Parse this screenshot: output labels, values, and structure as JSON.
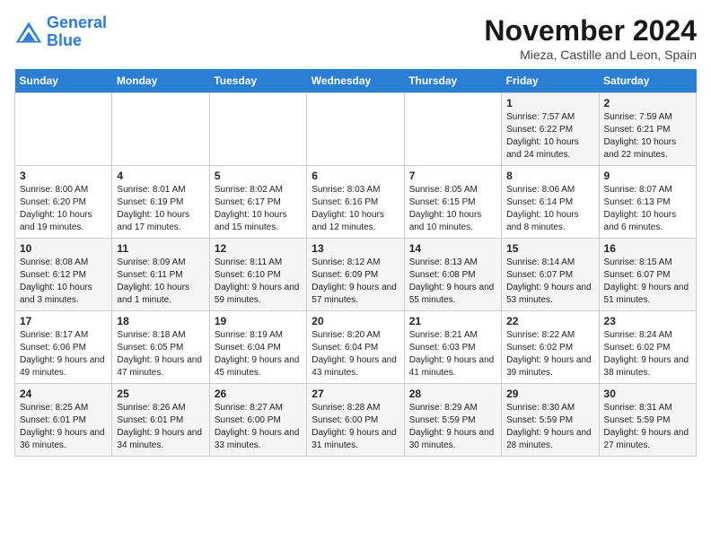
{
  "logo": {
    "line1": "General",
    "line2": "Blue"
  },
  "title": "November 2024",
  "subtitle": "Mieza, Castille and Leon, Spain",
  "weekdays": [
    "Sunday",
    "Monday",
    "Tuesday",
    "Wednesday",
    "Thursday",
    "Friday",
    "Saturday"
  ],
  "weeks": [
    [
      {
        "day": "",
        "info": ""
      },
      {
        "day": "",
        "info": ""
      },
      {
        "day": "",
        "info": ""
      },
      {
        "day": "",
        "info": ""
      },
      {
        "day": "",
        "info": ""
      },
      {
        "day": "1",
        "info": "Sunrise: 7:57 AM\nSunset: 6:22 PM\nDaylight: 10 hours and 24 minutes."
      },
      {
        "day": "2",
        "info": "Sunrise: 7:59 AM\nSunset: 6:21 PM\nDaylight: 10 hours and 22 minutes."
      }
    ],
    [
      {
        "day": "3",
        "info": "Sunrise: 8:00 AM\nSunset: 6:20 PM\nDaylight: 10 hours and 19 minutes."
      },
      {
        "day": "4",
        "info": "Sunrise: 8:01 AM\nSunset: 6:19 PM\nDaylight: 10 hours and 17 minutes."
      },
      {
        "day": "5",
        "info": "Sunrise: 8:02 AM\nSunset: 6:17 PM\nDaylight: 10 hours and 15 minutes."
      },
      {
        "day": "6",
        "info": "Sunrise: 8:03 AM\nSunset: 6:16 PM\nDaylight: 10 hours and 12 minutes."
      },
      {
        "day": "7",
        "info": "Sunrise: 8:05 AM\nSunset: 6:15 PM\nDaylight: 10 hours and 10 minutes."
      },
      {
        "day": "8",
        "info": "Sunrise: 8:06 AM\nSunset: 6:14 PM\nDaylight: 10 hours and 8 minutes."
      },
      {
        "day": "9",
        "info": "Sunrise: 8:07 AM\nSunset: 6:13 PM\nDaylight: 10 hours and 6 minutes."
      }
    ],
    [
      {
        "day": "10",
        "info": "Sunrise: 8:08 AM\nSunset: 6:12 PM\nDaylight: 10 hours and 3 minutes."
      },
      {
        "day": "11",
        "info": "Sunrise: 8:09 AM\nSunset: 6:11 PM\nDaylight: 10 hours and 1 minute."
      },
      {
        "day": "12",
        "info": "Sunrise: 8:11 AM\nSunset: 6:10 PM\nDaylight: 9 hours and 59 minutes."
      },
      {
        "day": "13",
        "info": "Sunrise: 8:12 AM\nSunset: 6:09 PM\nDaylight: 9 hours and 57 minutes."
      },
      {
        "day": "14",
        "info": "Sunrise: 8:13 AM\nSunset: 6:08 PM\nDaylight: 9 hours and 55 minutes."
      },
      {
        "day": "15",
        "info": "Sunrise: 8:14 AM\nSunset: 6:07 PM\nDaylight: 9 hours and 53 minutes."
      },
      {
        "day": "16",
        "info": "Sunrise: 8:15 AM\nSunset: 6:07 PM\nDaylight: 9 hours and 51 minutes."
      }
    ],
    [
      {
        "day": "17",
        "info": "Sunrise: 8:17 AM\nSunset: 6:06 PM\nDaylight: 9 hours and 49 minutes."
      },
      {
        "day": "18",
        "info": "Sunrise: 8:18 AM\nSunset: 6:05 PM\nDaylight: 9 hours and 47 minutes."
      },
      {
        "day": "19",
        "info": "Sunrise: 8:19 AM\nSunset: 6:04 PM\nDaylight: 9 hours and 45 minutes."
      },
      {
        "day": "20",
        "info": "Sunrise: 8:20 AM\nSunset: 6:04 PM\nDaylight: 9 hours and 43 minutes."
      },
      {
        "day": "21",
        "info": "Sunrise: 8:21 AM\nSunset: 6:03 PM\nDaylight: 9 hours and 41 minutes."
      },
      {
        "day": "22",
        "info": "Sunrise: 8:22 AM\nSunset: 6:02 PM\nDaylight: 9 hours and 39 minutes."
      },
      {
        "day": "23",
        "info": "Sunrise: 8:24 AM\nSunset: 6:02 PM\nDaylight: 9 hours and 38 minutes."
      }
    ],
    [
      {
        "day": "24",
        "info": "Sunrise: 8:25 AM\nSunset: 6:01 PM\nDaylight: 9 hours and 36 minutes."
      },
      {
        "day": "25",
        "info": "Sunrise: 8:26 AM\nSunset: 6:01 PM\nDaylight: 9 hours and 34 minutes."
      },
      {
        "day": "26",
        "info": "Sunrise: 8:27 AM\nSunset: 6:00 PM\nDaylight: 9 hours and 33 minutes."
      },
      {
        "day": "27",
        "info": "Sunrise: 8:28 AM\nSunset: 6:00 PM\nDaylight: 9 hours and 31 minutes."
      },
      {
        "day": "28",
        "info": "Sunrise: 8:29 AM\nSunset: 5:59 PM\nDaylight: 9 hours and 30 minutes."
      },
      {
        "day": "29",
        "info": "Sunrise: 8:30 AM\nSunset: 5:59 PM\nDaylight: 9 hours and 28 minutes."
      },
      {
        "day": "30",
        "info": "Sunrise: 8:31 AM\nSunset: 5:59 PM\nDaylight: 9 hours and 27 minutes."
      }
    ]
  ]
}
